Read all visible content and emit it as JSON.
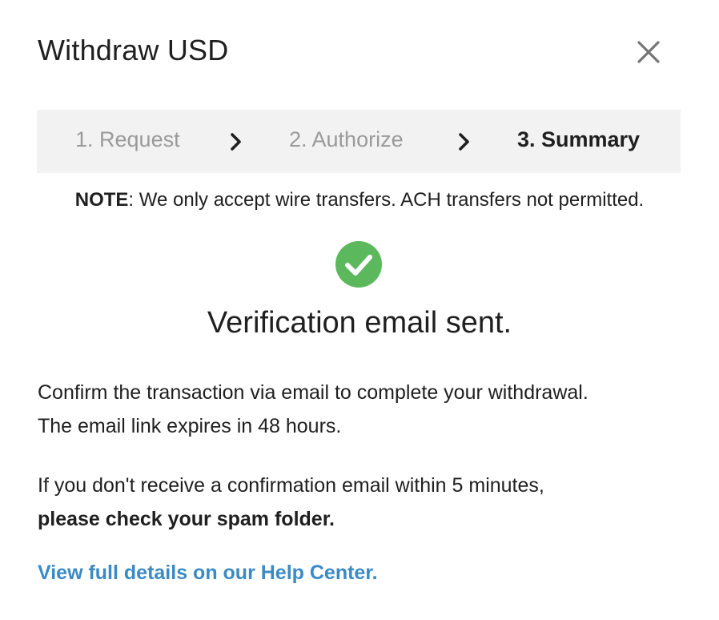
{
  "dialog": {
    "title": "Withdraw USD",
    "close_icon": "close-icon"
  },
  "stepper": {
    "steps": [
      {
        "label": "1. Request",
        "state": "inactive"
      },
      {
        "label": "2. Authorize",
        "state": "inactive"
      },
      {
        "label": "3. Summary",
        "state": "active"
      }
    ],
    "separator_icon": "chevron-right-icon"
  },
  "note": {
    "prefix": "NOTE",
    "text": ": We only accept wire transfers. ACH transfers not permitted."
  },
  "status": {
    "icon": "check-circle-icon",
    "icon_color": "#5cb85c",
    "headline": "Verification email sent."
  },
  "body": {
    "line1": "Confirm the transaction via email to complete your withdrawal.",
    "line2": "The email link expires in 48 hours.",
    "line3": "If you don't receive a confirmation email within 5 minutes,",
    "line4_bold": "please check your spam folder."
  },
  "help": {
    "link_text": "View full details on our Help Center.",
    "link_color": "#3b8ac4"
  }
}
